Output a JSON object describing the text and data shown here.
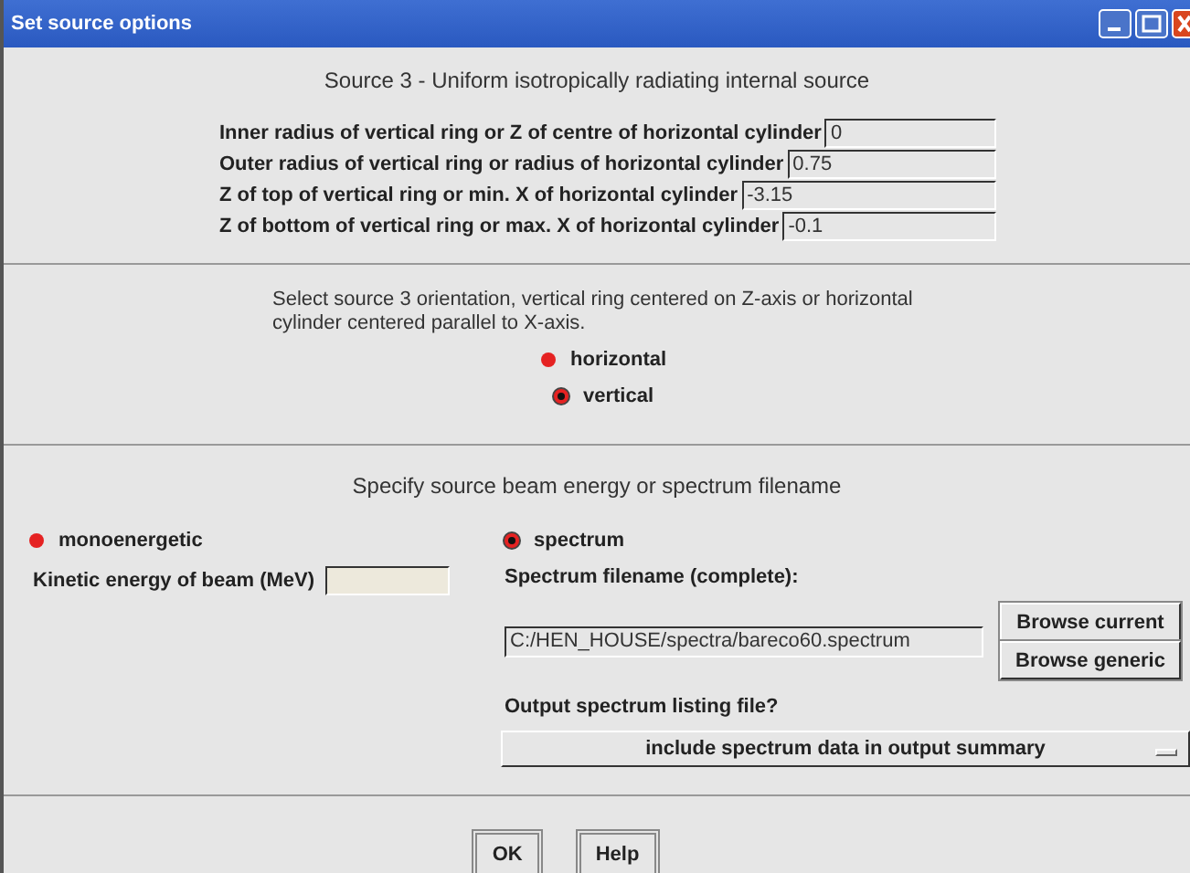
{
  "window": {
    "title": "Set source options"
  },
  "source_section": {
    "heading": "Source 3 - Uniform isotropically radiating internal source",
    "fields": [
      {
        "label": "Inner radius of vertical ring or Z of centre of horizontal cylinder",
        "value": "0"
      },
      {
        "label": "Outer radius of vertical ring or radius of horizontal cylinder",
        "value": "0.75"
      },
      {
        "label": "Z of top of vertical ring or min. X of horizontal cylinder",
        "value": "-3.15"
      },
      {
        "label": "Z of bottom of vertical ring or max. X of horizontal cylinder",
        "value": "-0.1"
      }
    ]
  },
  "orientation_section": {
    "text": "Select source 3 orientation,  vertical ring centered on Z-axis or horizontal cylinder centered parallel to X-axis.",
    "options": [
      {
        "label": "horizontal",
        "selected": false
      },
      {
        "label": "vertical",
        "selected": true
      }
    ]
  },
  "energy_section": {
    "heading": "Specify source beam energy or spectrum filename",
    "monoenergetic": {
      "label": "monoenergetic",
      "selected": false,
      "energy_label": "Kinetic energy of beam (MeV)"
    },
    "spectrum": {
      "label": "spectrum",
      "selected": true,
      "filename_label": "Spectrum filename (complete):",
      "filename": "C:/HEN_HOUSE/spectra/bareco60.spectrum",
      "browse_buttons": [
        "Browse current",
        "Browse generic"
      ],
      "output_label": "Output spectrum listing file?",
      "output_choice": "include spectrum data in output summary"
    }
  },
  "buttons": [
    "OK",
    "Help"
  ]
}
